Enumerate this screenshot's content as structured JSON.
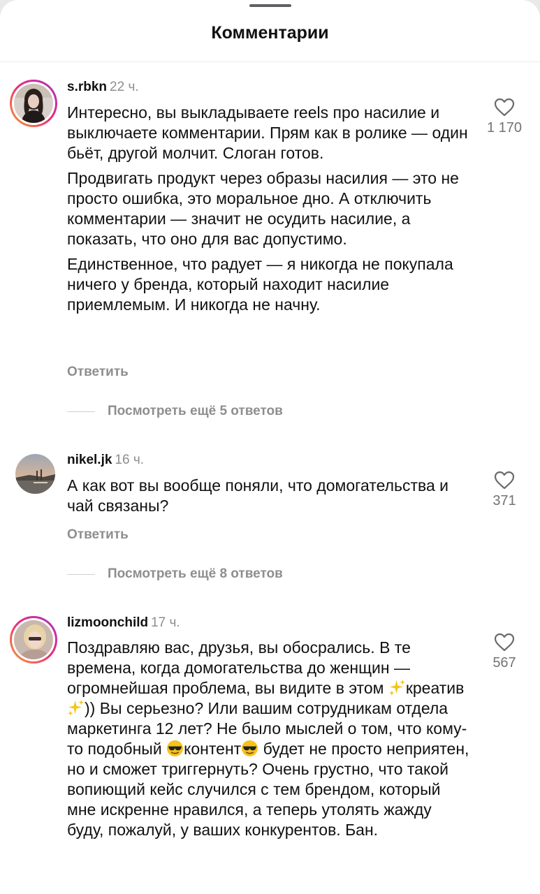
{
  "sheet": {
    "title": "Комментарии"
  },
  "comments": [
    {
      "username": "s.rbkn",
      "time": "22 ч.",
      "paragraphs": [
        "Интересно, вы выкладываете reels про насилие и выключаете комментарии. Прям как в ролике — один бьёт, другой молчит. Слоган готов.",
        "Продвигать продукт через образы насилия — это не просто ошибка, это моральное дно. А отключить комментарии — значит не осудить насилие, а показать, что оно для вас допустимо.",
        "Единственное, что радует — я никогда не покупала ничего у бренда, который находит насилие приемлемым. И никогда не начну."
      ],
      "likes": "1 170",
      "reply_label": "Ответить",
      "more_replies": "Посмотреть ещё 5 ответов"
    },
    {
      "username": "nikel.jk",
      "time": "16 ч.",
      "paragraphs": [
        "А как вот вы вообще поняли, что домогательства и чай связаны?"
      ],
      "likes": "371",
      "reply_label": "Ответить",
      "more_replies": "Посмотреть ещё 8 ответов"
    },
    {
      "username": "lizmoonchild",
      "time": "17 ч.",
      "text_parts": [
        "Поздравляю вас, друзья, вы обосрались. В те времена, когда домогательства до женщин — огромнейшая проблема, вы видите в этом ",
        "креатив",
        ")) Вы серьезно? Или вашим сотрудникам отдела маркетинга 12 лет? Не было мыслей о том, что кому-то подобный ",
        "контент",
        " будет не просто неприятен, но и сможет триггернуть? Очень грустно, что такой вопиющий кейс случился с тем брендом, который мне искренне нравился, а теперь утолять жажду буду, пожалуй, у ваших конкурентов. Бан."
      ],
      "likes": "567"
    }
  ],
  "icons": {
    "like": "heart-outline-icon",
    "sparkles": "sparkles-emoji-icon",
    "sunglasses": "sunglasses-emoji-icon"
  }
}
